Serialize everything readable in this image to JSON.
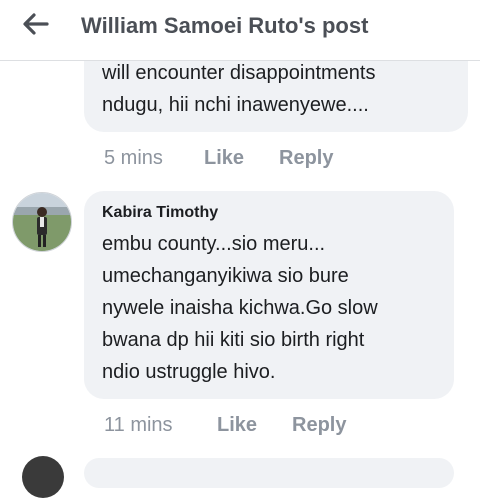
{
  "header": {
    "title": "William Samoei Ruto's post",
    "back_icon": "arrow-left-icon"
  },
  "comments": [
    {
      "lines": [
        "will encounter disappointments",
        "ndugu, hii nchi inawenyewe...."
      ],
      "time": "5 mins",
      "like_label": "Like",
      "reply_label": "Reply"
    },
    {
      "author": "Kabira Timothy",
      "lines": [
        "embu county...sio meru...",
        "umechanganyikiwa sio bure",
        "nywele inaisha kichwa.Go slow",
        "bwana dp hii kiti sio birth right",
        "ndio ustruggle hivo."
      ],
      "time": "11 mins",
      "like_label": "Like",
      "reply_label": "Reply"
    }
  ],
  "colors": {
    "bubble": "#f0f2f5",
    "meta_text": "#8d949e",
    "header_text": "#4b4f56",
    "body_text": "#1c1e21"
  }
}
